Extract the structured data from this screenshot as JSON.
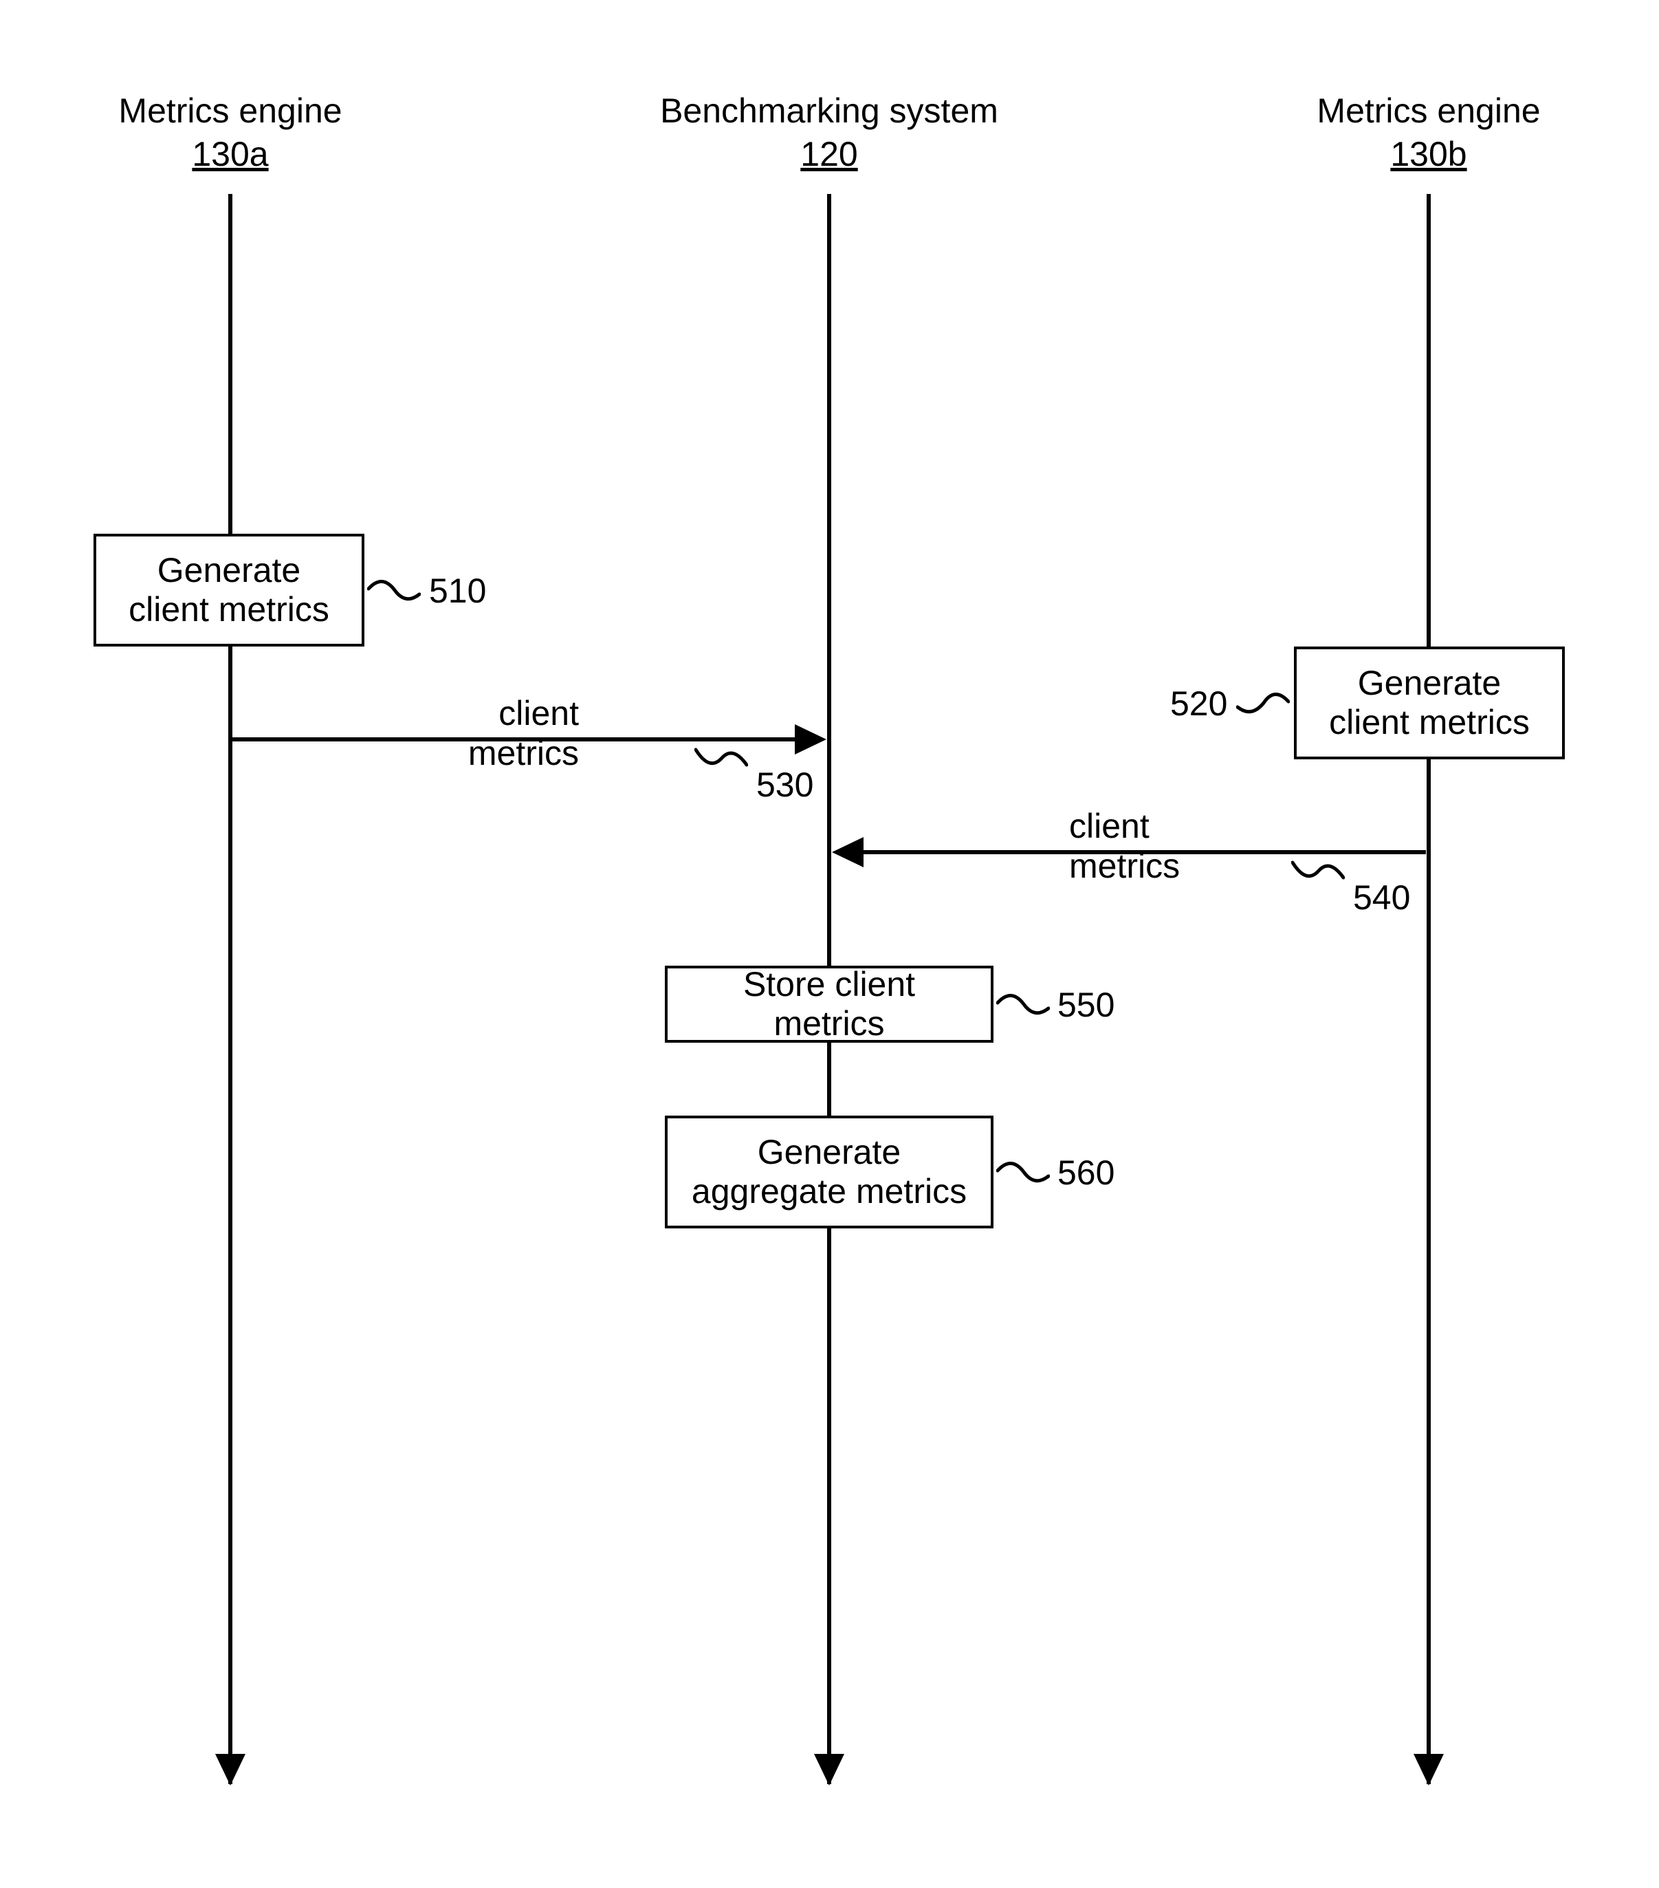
{
  "lanes": {
    "left": {
      "title": "Metrics engine",
      "ref": "130a"
    },
    "center": {
      "title": "Benchmarking system",
      "ref": "120"
    },
    "right": {
      "title": "Metrics engine",
      "ref": "130b"
    }
  },
  "boxes": {
    "b510": {
      "text": "Generate client metrics",
      "ref": "510"
    },
    "b520": {
      "text": "Generate client metrics",
      "ref": "520"
    },
    "b550": {
      "text": "Store client metrics",
      "ref": "550"
    },
    "b560": {
      "text": "Generate aggregate metrics",
      "ref": "560"
    }
  },
  "messages": {
    "m530": {
      "text": "client metrics",
      "ref": "530"
    },
    "m540": {
      "text": "client metrics",
      "ref": "540"
    }
  },
  "chart_data": {
    "type": "sequence-diagram",
    "participants": [
      {
        "id": "130a",
        "label": "Metrics engine 130a"
      },
      {
        "id": "120",
        "label": "Benchmarking system 120"
      },
      {
        "id": "130b",
        "label": "Metrics engine 130b"
      }
    ],
    "steps": [
      {
        "ref": "510",
        "at": "130a",
        "action": "Generate client metrics"
      },
      {
        "ref": "520",
        "at": "130b",
        "action": "Generate client metrics"
      },
      {
        "ref": "530",
        "from": "130a",
        "to": "120",
        "message": "client metrics"
      },
      {
        "ref": "540",
        "from": "130b",
        "to": "120",
        "message": "client metrics"
      },
      {
        "ref": "550",
        "at": "120",
        "action": "Store client metrics"
      },
      {
        "ref": "560",
        "at": "120",
        "action": "Generate aggregate metrics"
      }
    ]
  }
}
